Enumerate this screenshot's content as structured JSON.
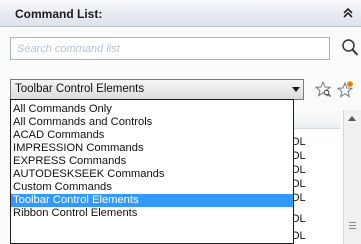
{
  "header": {
    "title": "Command List:",
    "collapse_icon": "double-chevron-up-icon"
  },
  "search": {
    "placeholder": "Search command list",
    "value": "",
    "icon": "magnifier-icon"
  },
  "filter_combo": {
    "selected": "Toolbar Control Elements",
    "options": [
      "All Commands Only",
      "All Commands and Controls",
      "ACAD Commands",
      "IMPRESSION Commands",
      "EXPRESS Commands",
      "AUTODESKSEEK Commands",
      "Custom Commands",
      "Toolbar Control Elements",
      "Ribbon Control Elements"
    ],
    "selected_index": 7
  },
  "toolbar_icons": [
    "find-star-icon",
    "new-star-icon"
  ],
  "background_list": {
    "column_fragments": [
      "OL",
      "OL",
      "OL",
      "OL",
      "OL",
      "OL",
      "OL"
    ]
  },
  "colors": {
    "selection": "#3399ff",
    "header_border": "#b7c0ca"
  }
}
